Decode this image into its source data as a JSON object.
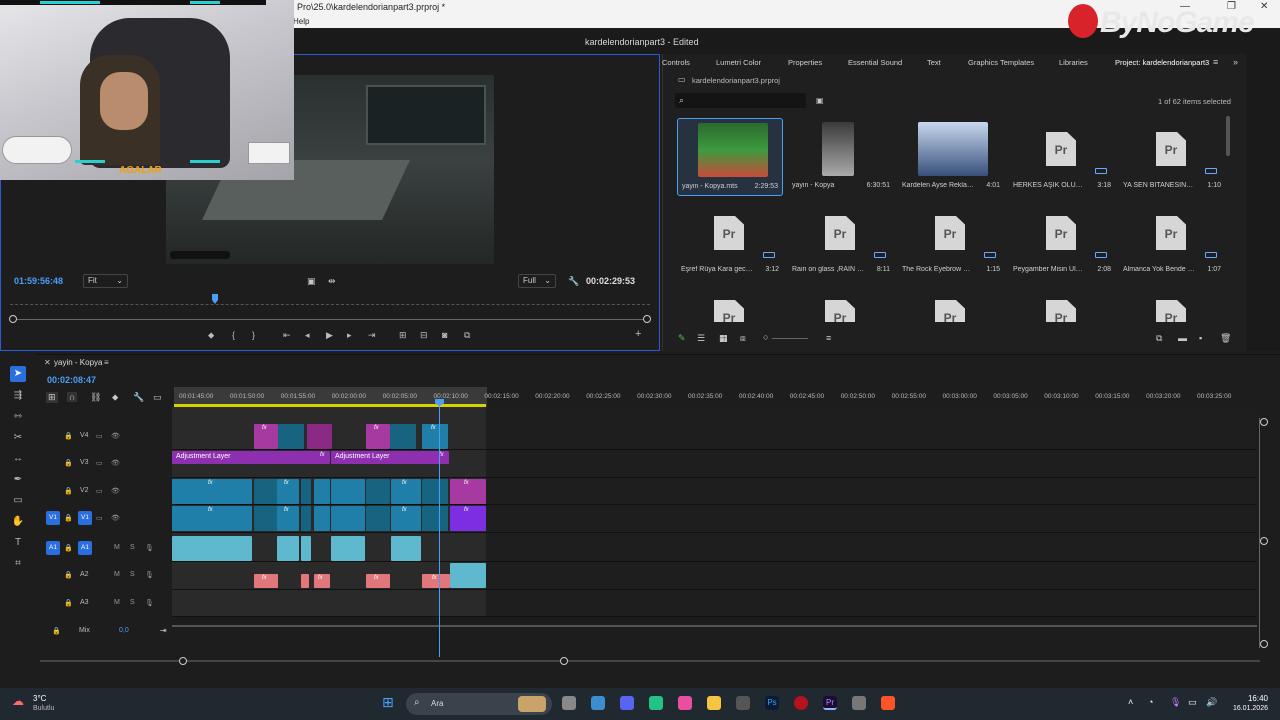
{
  "window": {
    "title_path": "Pro\\25.0\\kardelendorianpart3.prproj *",
    "menu_help": "Help",
    "app_title": "kardelendorianpart3 - Edited",
    "brand_logo": "ByNoGame",
    "stream_overlay_text": "AGALAR"
  },
  "monitor": {
    "timecode_left": "01:59:56:48",
    "fit_select": "Fit",
    "res_select": "Full",
    "timecode_right": "00:02:29:53"
  },
  "project_panel": {
    "tabs": [
      "Controls",
      "Lumetri Color",
      "Properties",
      "Essential Sound",
      "Text",
      "Graphics Templates",
      "Libraries",
      "Project: kardelendorianpart3"
    ],
    "path": "kardelendorianpart3.prproj",
    "search_placeholder": "",
    "selection_count": "1 of 62 items selected",
    "clips": [
      {
        "name": "yayin - Kopya.mts",
        "duration": "2:29:53",
        "thumb": "game"
      },
      {
        "name": "yayin - Kopya",
        "duration": "6:30:51",
        "thumb": "person"
      },
      {
        "name": "Kardelen Ayse Reklam ...",
        "duration": "4:01",
        "thumb": "class"
      },
      {
        "name": "HERKES AŞIK OLUR B...",
        "duration": "3:18",
        "thumb": "pr"
      },
      {
        "name": "YA SEN BITANESIN (3...",
        "duration": "1:10",
        "thumb": "pr"
      },
      {
        "name": "Eşref Rüya Kara geceler...",
        "duration": "3:12",
        "thumb": "pr"
      },
      {
        "name": "Rain on glass ,RAIN eff...",
        "duration": "8:11",
        "thumb": "pr"
      },
      {
        "name": "The Rock Eyebrow Rai...",
        "duration": "1:15",
        "thumb": "pr"
      },
      {
        "name": "Peygamber Misin Ulan...",
        "duration": "2:08",
        "thumb": "pr"
      },
      {
        "name": "Almanca Yok Bende Ka...",
        "duration": "1:07",
        "thumb": "pr"
      },
      {
        "name": "",
        "duration": "",
        "thumb": "pr"
      },
      {
        "name": "",
        "duration": "",
        "thumb": "pr"
      },
      {
        "name": "",
        "duration": "",
        "thumb": "pr"
      },
      {
        "name": "",
        "duration": "",
        "thumb": "pr"
      },
      {
        "name": "",
        "duration": "",
        "thumb": "pr"
      }
    ],
    "pr_glyph": "Pr"
  },
  "timeline": {
    "sequence_name": "yayin - Kopya",
    "timecode": "00:02:08:47",
    "ruler_ticks": [
      "00:01:45:00",
      "00:01:50:00",
      "00:01:55:00",
      "00:02:00:00",
      "00:02:05:00",
      "00:02:10:00",
      "00:02:15:00",
      "00:02:20:00",
      "00:02:25:00",
      "00:02:30:00",
      "00:02:35:00",
      "00:02:40:00",
      "00:02:45:00",
      "00:02:50:00",
      "00:02:55:00",
      "00:03:00:00",
      "00:03:05:00",
      "00:03:10:00",
      "00:03:15:00",
      "00:03:20:00",
      "00:03:25:00"
    ],
    "tracks": [
      {
        "name": "V4",
        "src": "",
        "kind": "video"
      },
      {
        "name": "V3",
        "src": "",
        "kind": "video"
      },
      {
        "name": "V2",
        "src": "",
        "kind": "video"
      },
      {
        "name": "V1",
        "src": "V1",
        "kind": "video"
      },
      {
        "name": "A1",
        "src": "A1",
        "kind": "audio"
      },
      {
        "name": "A2",
        "src": "",
        "kind": "audio"
      },
      {
        "name": "A3",
        "src": "",
        "kind": "audio"
      }
    ],
    "mix_label": "Mix",
    "mix_value": "0,0",
    "adjustment_label": "Adjustment Layer",
    "fx": "fx"
  },
  "taskbar": {
    "weather_temp": "3°C",
    "weather_desc": "Bulutlu",
    "search_label": "Ara",
    "time": "16:40",
    "date": "16.01.2026"
  }
}
